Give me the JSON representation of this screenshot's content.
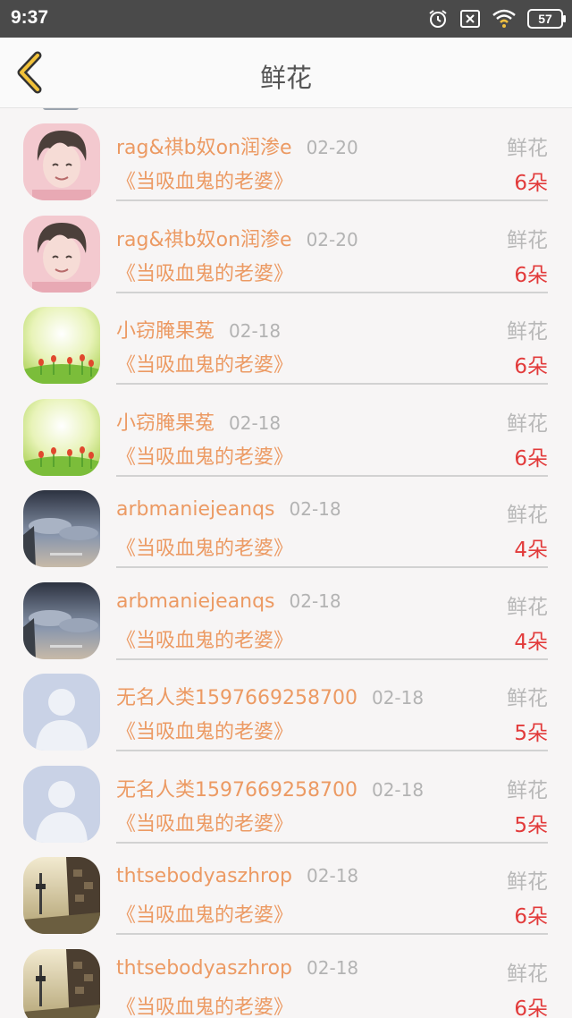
{
  "status": {
    "time": "9:37",
    "battery": "57"
  },
  "header": {
    "title": "鲜花"
  },
  "rows": [
    {
      "avatar": "anime-boy-avatar",
      "name": "rag&祺b奴on润渗e",
      "date": "02-20",
      "book": "《当吸血鬼的老婆》",
      "gift": "鲜花",
      "count": "6朵"
    },
    {
      "avatar": "anime-boy-avatar",
      "name": "rag&祺b奴on润渗e",
      "date": "02-20",
      "book": "《当吸血鬼的老婆》",
      "gift": "鲜花",
      "count": "6朵"
    },
    {
      "avatar": "tulip-field-avatar",
      "name": "小窃腌果菟",
      "date": "02-18",
      "book": "《当吸血鬼的老婆》",
      "gift": "鲜花",
      "count": "6朵"
    },
    {
      "avatar": "tulip-field-avatar",
      "name": "小窃腌果菟",
      "date": "02-18",
      "book": "《当吸血鬼的老婆》",
      "gift": "鲜花",
      "count": "6朵"
    },
    {
      "avatar": "cloudy-sky-avatar",
      "name": "arbmaniejeanqs",
      "date": "02-18",
      "book": "《当吸血鬼的老婆》",
      "gift": "鲜花",
      "count": "4朵"
    },
    {
      "avatar": "cloudy-sky-avatar",
      "name": "arbmaniejeanqs",
      "date": "02-18",
      "book": "《当吸血鬼的老婆》",
      "gift": "鲜花",
      "count": "4朵"
    },
    {
      "avatar": "default-person-avatar",
      "name": "无名人类1597669258700",
      "date": "02-18",
      "book": "《当吸血鬼的老婆》",
      "gift": "鲜花",
      "count": "5朵"
    },
    {
      "avatar": "default-person-avatar",
      "name": "无名人类1597669258700",
      "date": "02-18",
      "book": "《当吸血鬼的老婆》",
      "gift": "鲜花",
      "count": "5朵"
    },
    {
      "avatar": "street-scene-avatar",
      "name": "thtsebodyaszhrop",
      "date": "02-18",
      "book": "《当吸血鬼的老婆》",
      "gift": "鲜花",
      "count": "6朵"
    },
    {
      "avatar": "street-scene-avatar",
      "name": "thtsebodyaszhrop",
      "date": "02-18",
      "book": "《当吸血鬼的老婆》",
      "gift": "鲜花",
      "count": "6朵"
    }
  ]
}
